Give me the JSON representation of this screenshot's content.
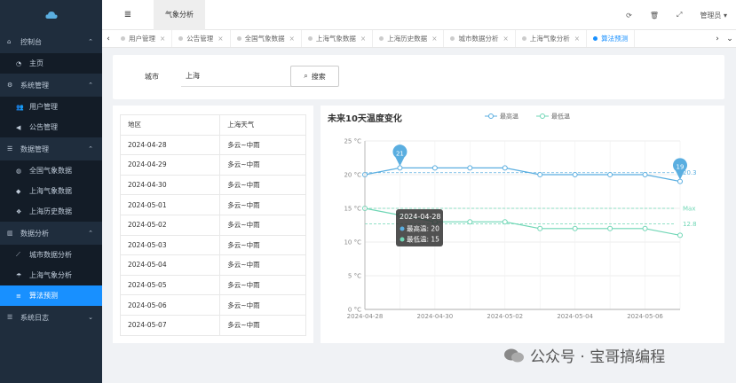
{
  "sidebar": {
    "logo_icon": "cloud-icon",
    "items": [
      {
        "type": "group",
        "label": "控制台",
        "icon": "home-icon",
        "open": true
      },
      {
        "type": "item",
        "label": "主页",
        "icon": "dashboard-icon"
      },
      {
        "type": "group",
        "label": "系统管理",
        "icon": "cogs-icon",
        "open": true
      },
      {
        "type": "item",
        "label": "用户管理",
        "icon": "users-icon"
      },
      {
        "type": "item",
        "label": "公告管理",
        "icon": "bullhorn-icon"
      },
      {
        "type": "group",
        "label": "数据管理",
        "icon": "list-icon",
        "open": true
      },
      {
        "type": "item",
        "label": "全国气象数据",
        "icon": "globe-icon"
      },
      {
        "type": "item",
        "label": "上海气象数据",
        "icon": "cube-icon"
      },
      {
        "type": "item",
        "label": "上海历史数据",
        "icon": "cubes-icon"
      },
      {
        "type": "group",
        "label": "数据分析",
        "icon": "bar-chart-icon",
        "open": true
      },
      {
        "type": "item",
        "label": "城市数据分析",
        "icon": "line-chart-icon"
      },
      {
        "type": "item",
        "label": "上海气象分析",
        "icon": "umbrella-icon"
      },
      {
        "type": "item",
        "label": "算法预测",
        "icon": "database-icon",
        "active": true
      },
      {
        "type": "group",
        "label": "系统日志",
        "icon": "list-icon",
        "open": false
      }
    ]
  },
  "topbar": {
    "menu_icon": "≣",
    "active_tab": "气象分析",
    "user": "管理员 ▾"
  },
  "tags": [
    {
      "label": "用户管理",
      "active": false
    },
    {
      "label": "公告管理",
      "active": false
    },
    {
      "label": "全国气象数据",
      "active": false
    },
    {
      "label": "上海气象数据",
      "active": false
    },
    {
      "label": "上海历史数据",
      "active": false
    },
    {
      "label": "城市数据分析",
      "active": false
    },
    {
      "label": "上海气象分析",
      "active": false
    },
    {
      "label": "算法预测",
      "active": true
    }
  ],
  "filter": {
    "city_label": "城市",
    "city_value": "上海",
    "search_label": "搜索"
  },
  "table": {
    "headers": [
      "地区",
      "上海天气"
    ],
    "rows": [
      [
        "2024-04-28",
        "多云~中雨"
      ],
      [
        "2024-04-29",
        "多云~中雨"
      ],
      [
        "2024-04-30",
        "多云~中雨"
      ],
      [
        "2024-05-01",
        "多云~中雨"
      ],
      [
        "2024-05-02",
        "多云~中雨"
      ],
      [
        "2024-05-03",
        "多云~中雨"
      ],
      [
        "2024-05-04",
        "多云~中雨"
      ],
      [
        "2024-05-05",
        "多云~中雨"
      ],
      [
        "2024-05-06",
        "多云~中雨"
      ],
      [
        "2024-05-07",
        "多云~中雨"
      ]
    ]
  },
  "chart_data": {
    "type": "line",
    "title": "未来10天温度变化",
    "x": [
      "2024-04-28",
      "2024-04-29",
      "2024-04-30",
      "2024-05-01",
      "2024-05-02",
      "2024-05-03",
      "2024-05-04",
      "2024-05-05",
      "2024-05-06",
      "2024-05-07"
    ],
    "x_tick_labels": [
      "2024-04-28",
      "2024-04-30",
      "2024-05-02",
      "2024-05-04",
      "2024-05-06"
    ],
    "y_ticks": [
      "0 °C",
      "5 °C",
      "10 °C",
      "15 °C",
      "20 °C",
      "25 °C"
    ],
    "ylim": [
      0,
      25
    ],
    "series": [
      {
        "name": "最高温",
        "color": "#5aaee0",
        "values": [
          20,
          21,
          21,
          21,
          21,
          20,
          20,
          20,
          20,
          19
        ]
      },
      {
        "name": "最低温",
        "color": "#6fd6b5",
        "values": [
          15,
          14,
          13,
          13,
          13,
          12,
          12,
          12,
          12,
          11
        ]
      }
    ],
    "markpoints": {
      "max_label": "21",
      "min_label": "19"
    },
    "marklines": {
      "max_label": "Max",
      "avg_high_label": "20.3",
      "avg_low_label": "12.8"
    },
    "tooltip": {
      "date": "2024-04-28",
      "high": "最高温: 20",
      "low": "最低温: 15"
    },
    "legend_position": "top-right"
  },
  "watermark": {
    "text": "公众号 · 宝哥搞编程"
  }
}
